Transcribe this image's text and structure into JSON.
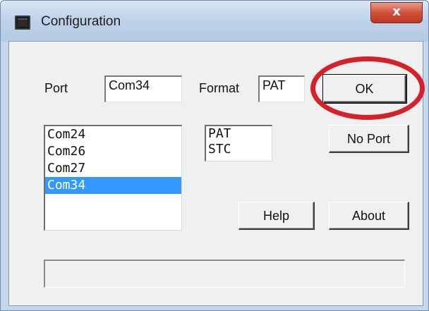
{
  "window": {
    "title": "Configuration",
    "close_label": "x",
    "colors": {
      "close_button": "#c1351f",
      "selection": "#3399ff",
      "annotation": "#d4212a"
    }
  },
  "port": {
    "label": "Port",
    "value": "Com34",
    "list": [
      "Com24",
      "Com26",
      "Com27",
      "Com34"
    ],
    "selected_item": "Com34"
  },
  "format": {
    "label": "Format",
    "value": "PAT",
    "list": [
      "PAT",
      "STC"
    ]
  },
  "buttons": {
    "ok": "OK",
    "no_port": "No Port",
    "help": "Help",
    "about": "About"
  },
  "status": {
    "text": ""
  },
  "annotation": {
    "shape": "red ellipse around OK button"
  }
}
